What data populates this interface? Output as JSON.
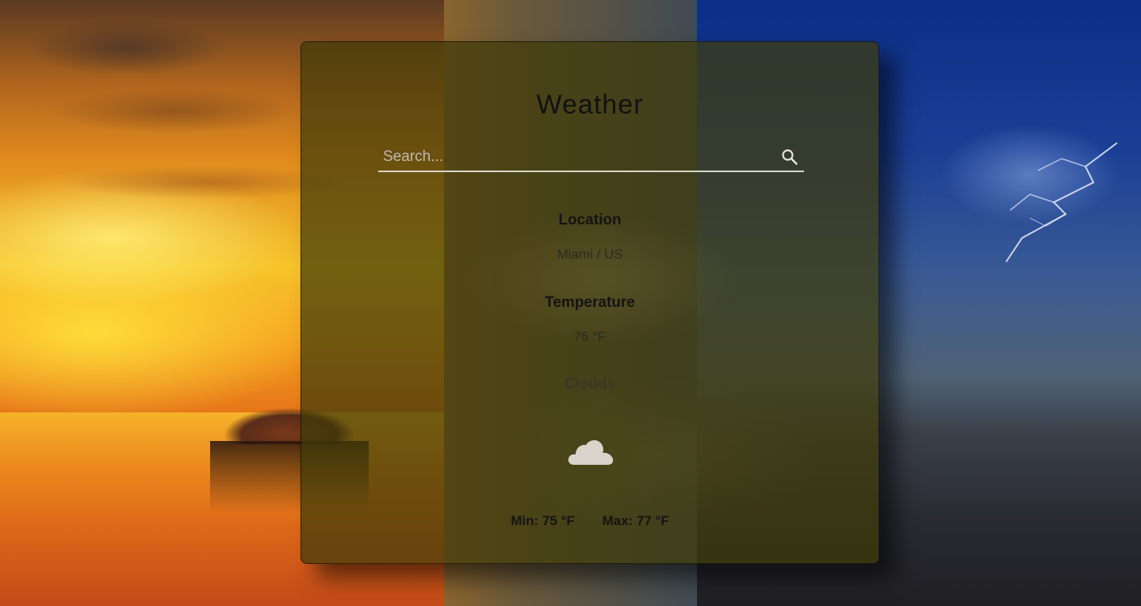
{
  "app": {
    "title": "Weather"
  },
  "search": {
    "placeholder": "Search...",
    "value": "",
    "icon": "search-icon"
  },
  "location": {
    "label": "Location",
    "value": "Miami / US"
  },
  "temperature": {
    "label": "Temperature",
    "value": "76 °F"
  },
  "condition": {
    "label": "Clouds",
    "icon": "cloud-icon"
  },
  "range": {
    "min": "Min: 75 °F",
    "max": "Max: 77 °F"
  },
  "colors": {
    "card_tint": "#3e3a08",
    "title_text": "#111111",
    "cloud": "#d8d4cc"
  }
}
